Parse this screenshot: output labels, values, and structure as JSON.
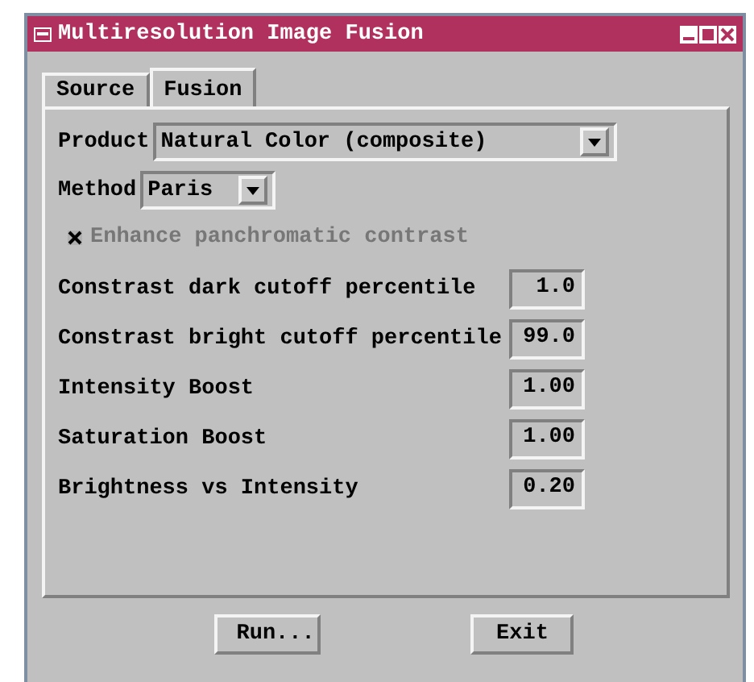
{
  "window": {
    "title": "Multiresolution Image Fusion"
  },
  "tabs": [
    {
      "label": "Source",
      "selected": false
    },
    {
      "label": "Fusion",
      "selected": true
    }
  ],
  "dropdowns": [
    {
      "label": "Product",
      "value": "Natural Color (composite)",
      "kind": "wide"
    },
    {
      "label": "Method",
      "value": "Paris",
      "kind": "narrow"
    }
  ],
  "checkbox": {
    "label": "Enhance panchromatic contrast",
    "checked": true,
    "disabled": true
  },
  "parameters": [
    {
      "label": "Constrast dark cutoff percentile",
      "value": "1.0"
    },
    {
      "label": "Constrast bright cutoff percentile",
      "value": "99.0"
    },
    {
      "label": "Intensity Boost",
      "value": "1.00"
    },
    {
      "label": "Saturation Boost",
      "value": "1.00"
    },
    {
      "label": "Brightness vs Intensity",
      "value": "0.20"
    }
  ],
  "buttons": [
    "Run...",
    "Exit"
  ]
}
